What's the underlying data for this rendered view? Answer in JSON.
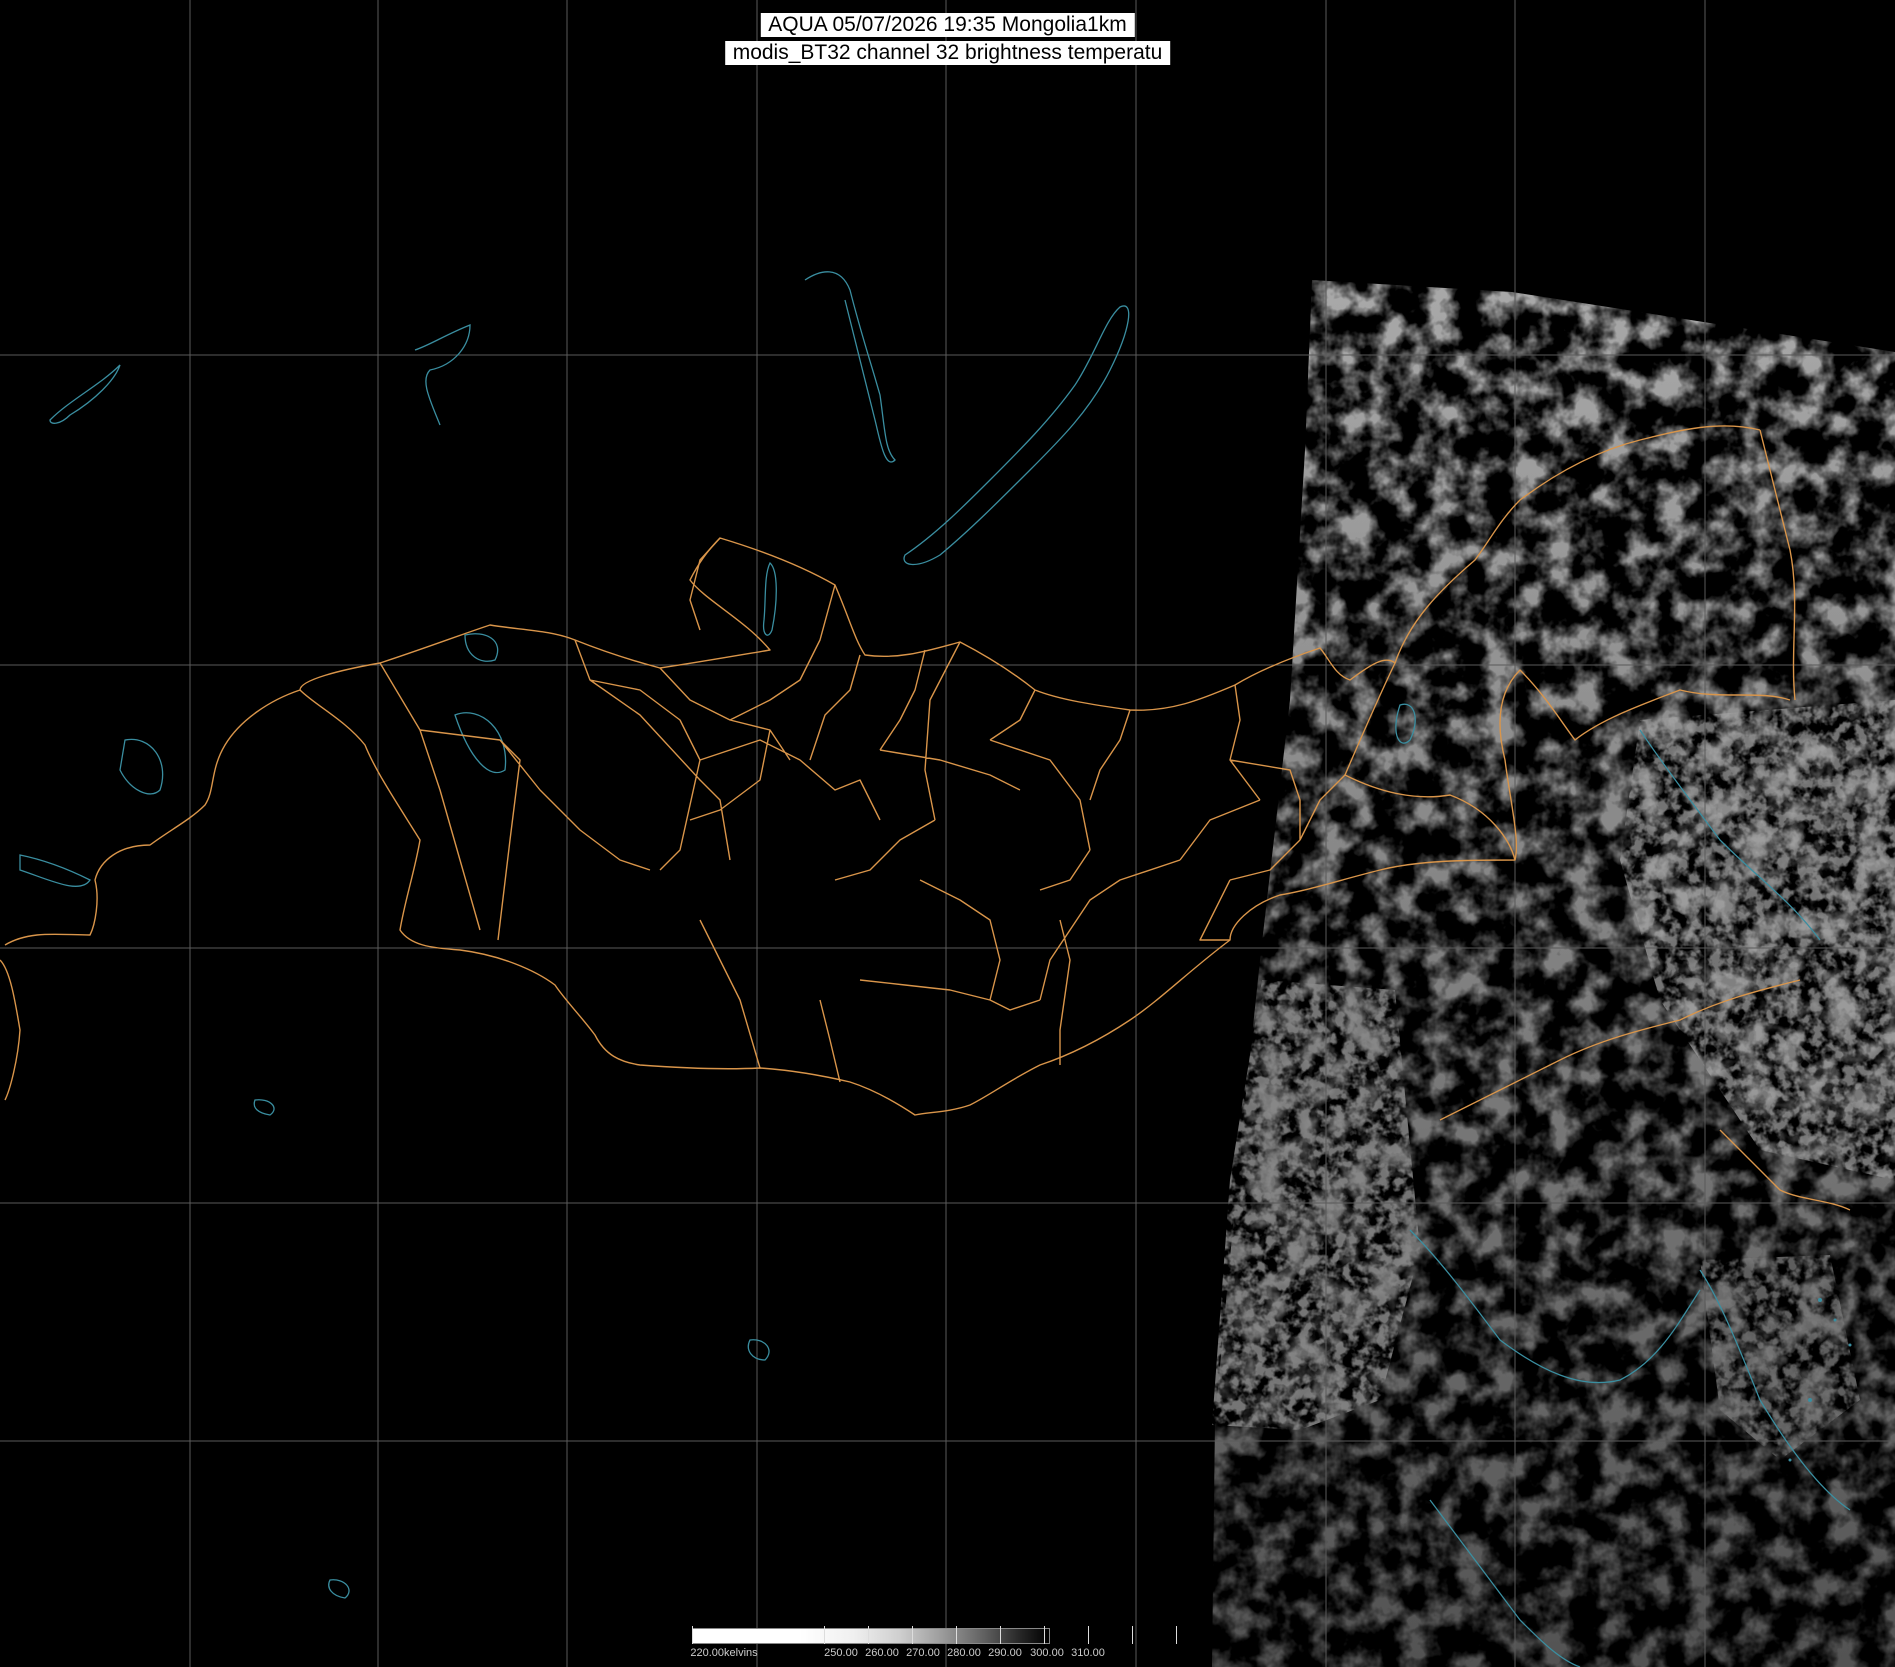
{
  "title": {
    "line1": "AQUA 05/07/2026 19:35 Mongolia1km",
    "line2": "modis_BT32 channel 32 brightness temperatu"
  },
  "colors": {
    "background": "#000000",
    "grid": "#5a5a5a",
    "borders": "#d9954a",
    "water": "#3a8ea0",
    "imagery": "#9a9a9a"
  },
  "colorbar": {
    "labels": [
      "220.00kelvins",
      "250.00",
      "260.00",
      "270.00",
      "280.00",
      "290.00",
      "300.00",
      "310.00"
    ]
  }
}
